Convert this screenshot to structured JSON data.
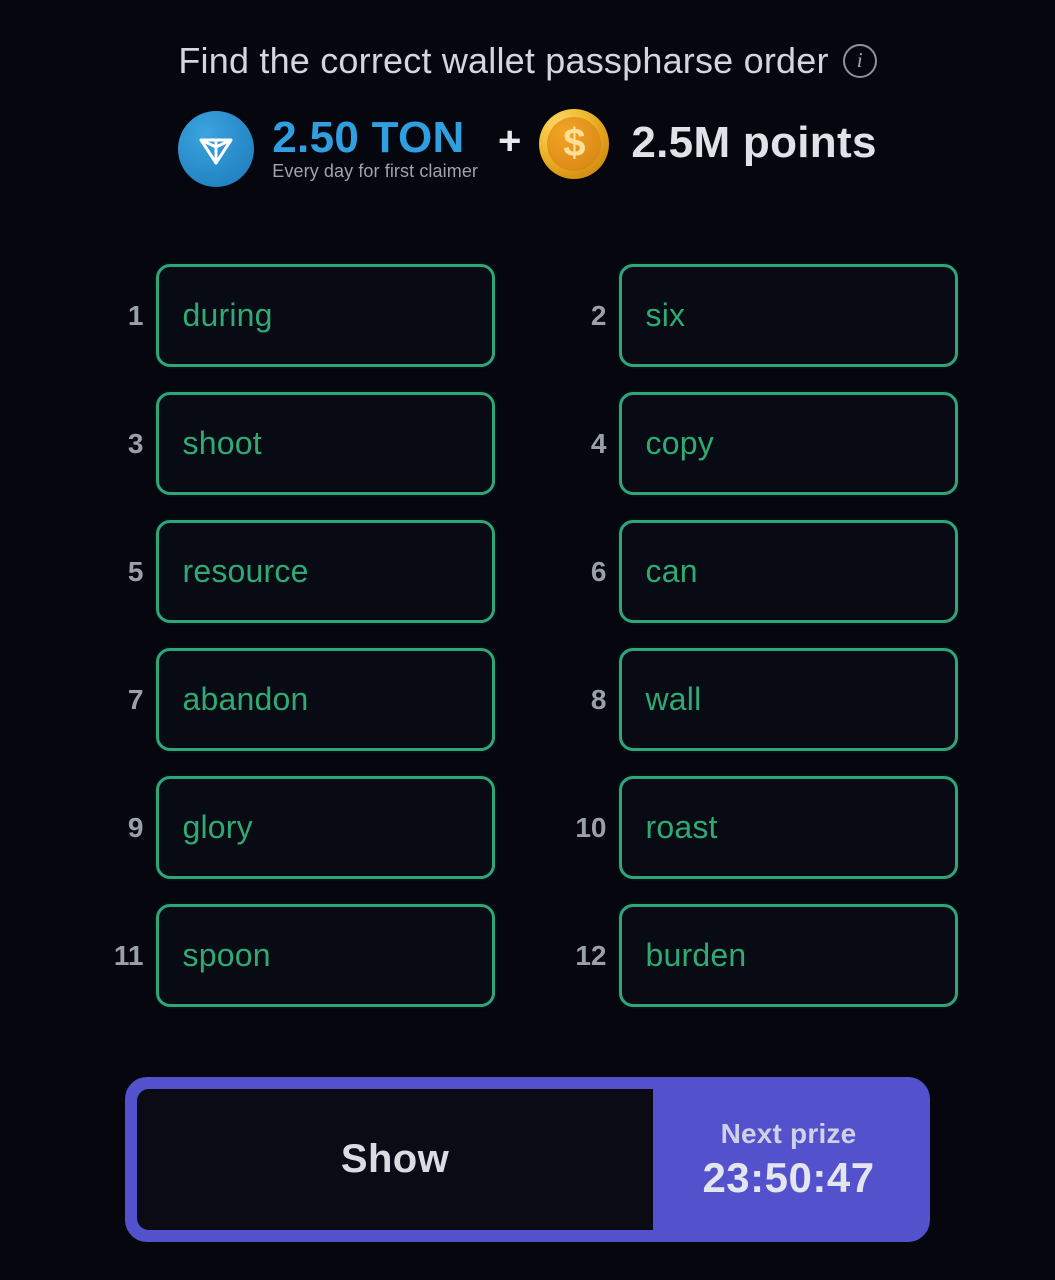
{
  "header": {
    "title": "Find the correct wallet passpharse order",
    "info_icon": "info-icon",
    "info_glyph": "i"
  },
  "prize": {
    "ton_icon": "ton-logo-icon",
    "ton_amount": "2.50 TON",
    "ton_note": "Every day for first claimer",
    "plus": "+",
    "coin_icon": "coin-icon",
    "coin_glyph": "$",
    "points_amount": "2.5M points"
  },
  "grid": {
    "cells": [
      {
        "index": "1",
        "word": "during"
      },
      {
        "index": "2",
        "word": "six"
      },
      {
        "index": "3",
        "word": "shoot"
      },
      {
        "index": "4",
        "word": "copy"
      },
      {
        "index": "5",
        "word": "resource"
      },
      {
        "index": "6",
        "word": "can"
      },
      {
        "index": "7",
        "word": "abandon"
      },
      {
        "index": "8",
        "word": "wall"
      },
      {
        "index": "9",
        "word": "glory"
      },
      {
        "index": "10",
        "word": "roast"
      },
      {
        "index": "11",
        "word": "spoon"
      },
      {
        "index": "12",
        "word": "burden"
      }
    ]
  },
  "bottom": {
    "show_label": "Show",
    "next_prize_label": "Next prize",
    "next_prize_time": "23:50:47"
  },
  "colors": {
    "background": "#05060e",
    "word_border": "#2fa677",
    "word_text": "#2faa72",
    "index_text": "#9aa0a8",
    "ton_blue": "#2f9fe0",
    "coin_gold": "#f0b92e",
    "accent_purple": "#5351cc",
    "title_text": "#d3d6dc"
  }
}
